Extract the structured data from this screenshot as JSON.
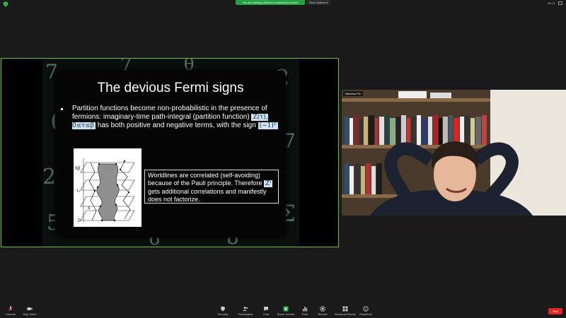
{
  "top_bar": {
    "banner": "You are viewing Wilhelm Fuellmann's screen",
    "view_options": "View Options",
    "time": "08:13"
  },
  "slide": {
    "title": "The devious Fermi signs",
    "bullet_part1": "Partition functions become non-probabilistic in the presence of fermions: imaginary-time path-integral (partition function)",
    "bullet_math1": "Z(τ),  0≤τ≤β",
    "bullet_part2": "has both positive and negative terms, with the sign",
    "bullet_math2": "(−1)ᴾ",
    "worldlines_part1": "Worldlines are correlated (self-avoiding) because of the Pauli principle. Therefore",
    "worldlines_math": "Zᶠ",
    "worldlines_part2": "gets additional correlations and manifestly does not factorize.",
    "figure_labels": [
      "hβ",
      "τ₁",
      "x",
      "0"
    ]
  },
  "participant": {
    "name": "Nemeno Pic"
  },
  "toolbar": {
    "items": [
      {
        "label": "Unmute",
        "icon": "microphone-muted-icon"
      },
      {
        "label": "Stop Video",
        "icon": "video-camera-icon"
      },
      {
        "label": "Security",
        "icon": "shield-icon"
      },
      {
        "label": "Participants",
        "icon": "participants-icon",
        "count": "16"
      },
      {
        "label": "Chat",
        "icon": "chat-icon"
      },
      {
        "label": "Share Screen",
        "icon": "share-screen-icon"
      },
      {
        "label": "Polls",
        "icon": "polls-icon"
      },
      {
        "label": "Record",
        "icon": "record-icon"
      },
      {
        "label": "Breakout Rooms",
        "icon": "breakout-rooms-icon"
      },
      {
        "label": "Reactions",
        "icon": "reactions-icon"
      }
    ],
    "end_label": "End"
  },
  "colors": {
    "share_border": "#6cbf3a",
    "banner": "#25a244",
    "end": "#e02828"
  }
}
